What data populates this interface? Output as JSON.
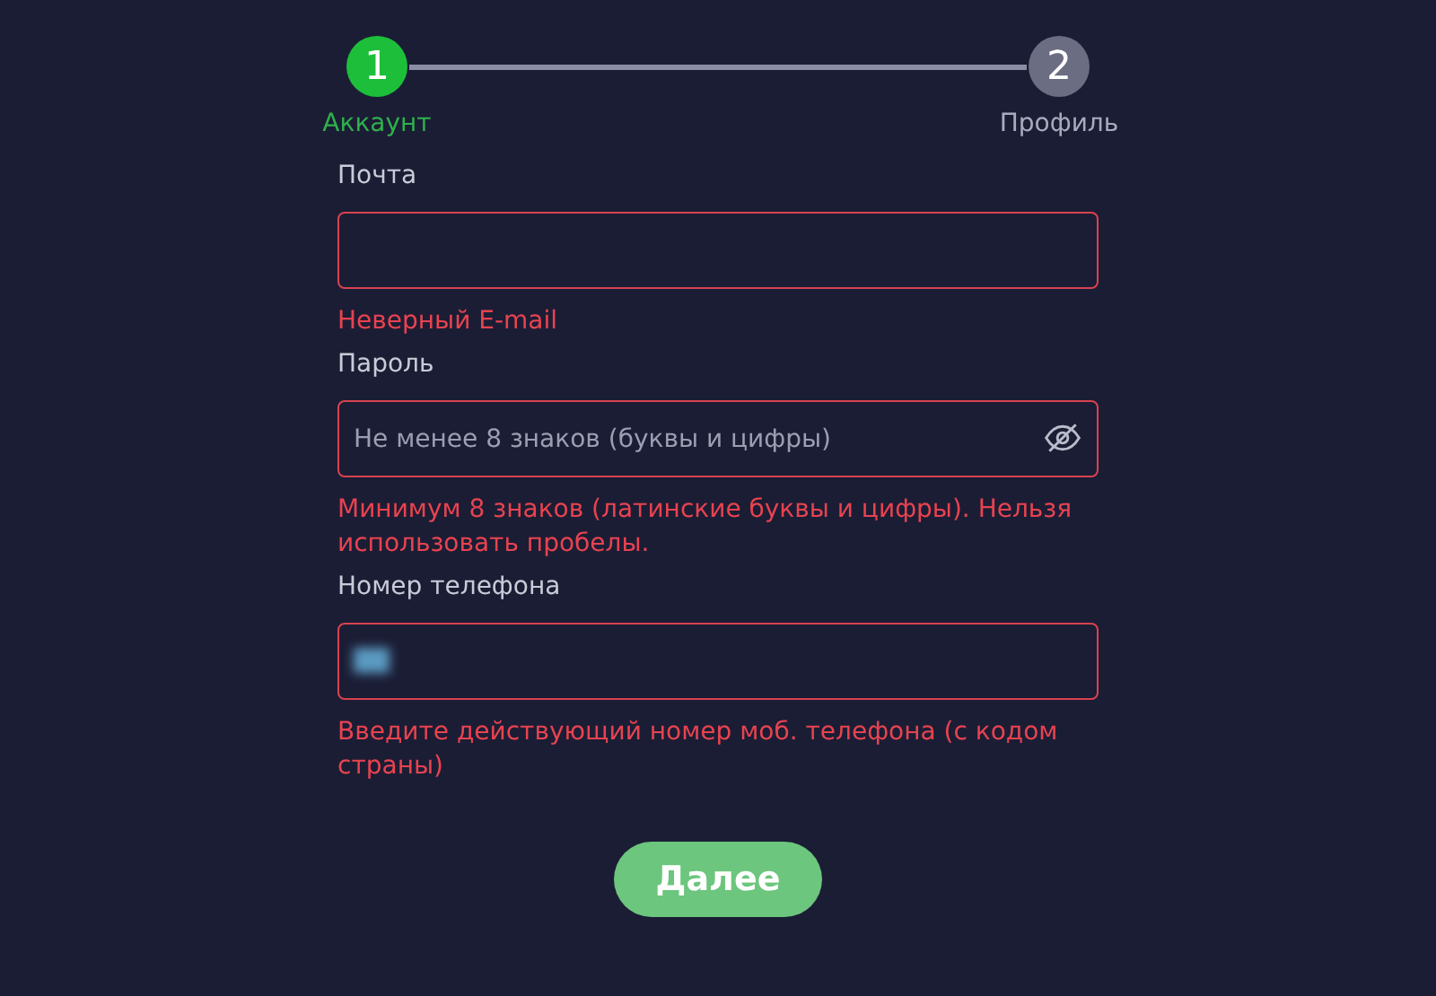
{
  "steps": [
    {
      "number": "1",
      "label": "Аккаунт",
      "selected": true
    },
    {
      "number": "2",
      "label": "Профиль",
      "selected": false
    }
  ],
  "fields": [
    {
      "kind": "email",
      "label": "Почта",
      "error": "Неверный E-mail"
    },
    {
      "kind": "password",
      "label": "Пароль",
      "placeholder": "Не менее 8 знаков (буквы и цифры)",
      "error": "Минимум 8 знаков (латинские буквы и цифры). Нельзя использовать пробелы."
    },
    {
      "kind": "phone",
      "label": "Номер телефона",
      "error": "Введите действующий номер моб. телефона (с кодом страны)"
    }
  ],
  "submit": {
    "label": "Далее"
  }
}
